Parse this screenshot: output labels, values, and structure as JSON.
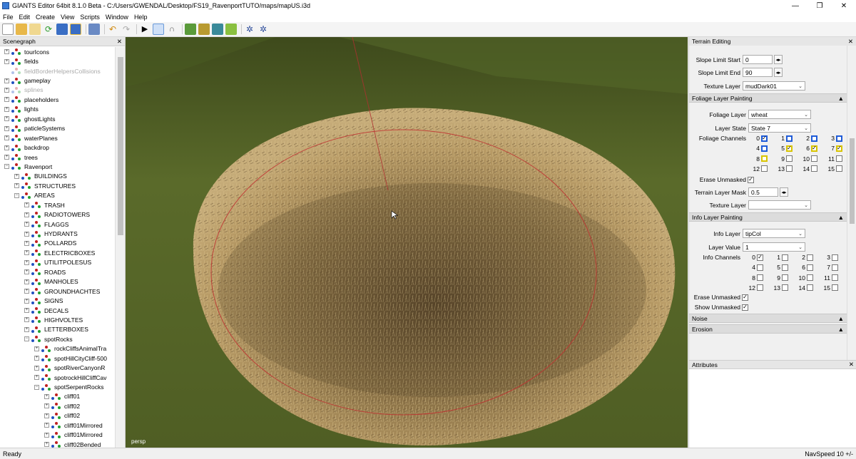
{
  "window": {
    "title": "GIANTS Editor 64bit 8.1.0 Beta - C:/Users/GWENDAL/Desktop/FS19_RavenportTUTO/maps/mapUS.i3d",
    "minimize": "—",
    "maximize": "❐",
    "close": "✕"
  },
  "menu": [
    "File",
    "Edit",
    "Create",
    "View",
    "Scripts",
    "Window",
    "Help"
  ],
  "scenegraph": {
    "title": "Scenegraph",
    "close": "✕",
    "nodes": [
      {
        "label": "tourIcons",
        "depth": 0,
        "exp": "+"
      },
      {
        "label": "fields",
        "depth": 0,
        "exp": "+"
      },
      {
        "label": "fieldBorderHelpersCollisions",
        "depth": 0,
        "exp": "",
        "dim": true
      },
      {
        "label": "gameplay",
        "depth": 0,
        "exp": "+"
      },
      {
        "label": "splines",
        "depth": 0,
        "exp": "+",
        "dim": true
      },
      {
        "label": "placeholders",
        "depth": 0,
        "exp": "+"
      },
      {
        "label": "lights",
        "depth": 0,
        "exp": "+"
      },
      {
        "label": "ghostLights",
        "depth": 0,
        "exp": "+"
      },
      {
        "label": "paticleSystems",
        "depth": 0,
        "exp": "+"
      },
      {
        "label": "waterPlanes",
        "depth": 0,
        "exp": "+"
      },
      {
        "label": "backdrop",
        "depth": 0,
        "exp": "+"
      },
      {
        "label": "trees",
        "depth": 0,
        "exp": "+"
      },
      {
        "label": "Ravenport",
        "depth": 0,
        "exp": "−"
      },
      {
        "label": "BUILDINGS",
        "depth": 1,
        "exp": "+"
      },
      {
        "label": "STRUCTURES",
        "depth": 1,
        "exp": "+"
      },
      {
        "label": "AREAS",
        "depth": 1,
        "exp": "−"
      },
      {
        "label": "TRASH",
        "depth": 2,
        "exp": "+"
      },
      {
        "label": "RADIOTOWERS",
        "depth": 2,
        "exp": "+"
      },
      {
        "label": "FLAGGS",
        "depth": 2,
        "exp": "+"
      },
      {
        "label": "HYDRANTS",
        "depth": 2,
        "exp": "+"
      },
      {
        "label": "POLLARDS",
        "depth": 2,
        "exp": "+"
      },
      {
        "label": "ELECTRICBOXES",
        "depth": 2,
        "exp": "+"
      },
      {
        "label": "UTILITPOLESUS",
        "depth": 2,
        "exp": "+"
      },
      {
        "label": "ROADS",
        "depth": 2,
        "exp": "+"
      },
      {
        "label": "MANHOLES",
        "depth": 2,
        "exp": "+"
      },
      {
        "label": "GROUNDHACHTES",
        "depth": 2,
        "exp": "+"
      },
      {
        "label": "SIGNS",
        "depth": 2,
        "exp": "+"
      },
      {
        "label": "DECALS",
        "depth": 2,
        "exp": "+"
      },
      {
        "label": "HIGHVOLTES",
        "depth": 2,
        "exp": "+"
      },
      {
        "label": "LETTERBOXES",
        "depth": 2,
        "exp": "+"
      },
      {
        "label": "spotRocks",
        "depth": 2,
        "exp": "−"
      },
      {
        "label": "rockCliffsAnimalTra",
        "depth": 3,
        "exp": "+"
      },
      {
        "label": "spotHillCityCliff-500",
        "depth": 3,
        "exp": "+"
      },
      {
        "label": "spotRiverCanyonR",
        "depth": 3,
        "exp": "+"
      },
      {
        "label": "spotrockHillCliffCav",
        "depth": 3,
        "exp": "+"
      },
      {
        "label": "spotSerpentRocks",
        "depth": 3,
        "exp": "−"
      },
      {
        "label": "cliff01",
        "depth": 4,
        "exp": "+"
      },
      {
        "label": "cliff02",
        "depth": 4,
        "exp": "+"
      },
      {
        "label": "cliff02",
        "depth": 4,
        "exp": "+"
      },
      {
        "label": "cliff01Mirrored",
        "depth": 4,
        "exp": "+"
      },
      {
        "label": "cliff01Mirrored",
        "depth": 4,
        "exp": "+"
      },
      {
        "label": "cliff02Bended",
        "depth": 4,
        "exp": "+"
      }
    ]
  },
  "viewport": {
    "label": "persp"
  },
  "terrain": {
    "title": "Terrain Editing",
    "close": "✕",
    "slope_start_label": "Slope Limit Start",
    "slope_start_value": "0",
    "slope_end_label": "Slope Limit End",
    "slope_end_value": "90",
    "texture_layer_label": "Texture Layer",
    "texture_layer_value": "mudDark01",
    "foliage_section": "Foliage Layer Painting",
    "foliage_layer_label": "Foliage Layer",
    "foliage_layer_value": "wheat",
    "layer_state_label": "Layer State",
    "layer_state_value": "State 7",
    "foliage_channels_label": "Foliage Channels",
    "foliage_channels": [
      {
        "n": "0",
        "s": "blue-checked"
      },
      {
        "n": "1",
        "s": "blue"
      },
      {
        "n": "2",
        "s": "blue"
      },
      {
        "n": "3",
        "s": "blue"
      },
      {
        "n": "4",
        "s": "blue"
      },
      {
        "n": "5",
        "s": "yellow-checked"
      },
      {
        "n": "6",
        "s": "yellow-checked"
      },
      {
        "n": "7",
        "s": "yellow-checked"
      },
      {
        "n": "8",
        "s": "yellow"
      },
      {
        "n": "9",
        "s": "plain"
      },
      {
        "n": "10",
        "s": "plain"
      },
      {
        "n": "11",
        "s": "plain"
      },
      {
        "n": "12",
        "s": "plain"
      },
      {
        "n": "13",
        "s": "plain"
      },
      {
        "n": "14",
        "s": "plain"
      },
      {
        "n": "15",
        "s": "plain"
      }
    ],
    "erase_unmasked_label": "Erase Unmasked",
    "layer_mask_label": "Terrain Layer Mask",
    "layer_mask_value": "0.5",
    "texture_layer2_label": "Texture Layer",
    "texture_layer2_value": "",
    "info_section": "Info Layer Painting",
    "info_layer_label": "Info Layer",
    "info_layer_value": "tipCol",
    "layer_value_label": "Layer Value",
    "layer_value_value": "1",
    "info_channels_label": "Info Channels",
    "info_channels": [
      {
        "n": "0",
        "s": "plain-checked"
      },
      {
        "n": "1",
        "s": "plain"
      },
      {
        "n": "2",
        "s": "plain"
      },
      {
        "n": "3",
        "s": "plain"
      },
      {
        "n": "4",
        "s": "plain"
      },
      {
        "n": "5",
        "s": "plain"
      },
      {
        "n": "6",
        "s": "plain"
      },
      {
        "n": "7",
        "s": "plain"
      },
      {
        "n": "8",
        "s": "plain"
      },
      {
        "n": "9",
        "s": "plain"
      },
      {
        "n": "10",
        "s": "plain"
      },
      {
        "n": "11",
        "s": "plain"
      },
      {
        "n": "12",
        "s": "plain"
      },
      {
        "n": "13",
        "s": "plain"
      },
      {
        "n": "14",
        "s": "plain"
      },
      {
        "n": "15",
        "s": "plain"
      }
    ],
    "erase_unmasked2_label": "Erase Unmasked",
    "show_unmasked_label": "Show Unmasked",
    "noise_section": "Noise",
    "erosion_section": "Erosion"
  },
  "attributes": {
    "title": "Attributes",
    "close": "✕"
  },
  "status": {
    "left": "Ready",
    "right": "NavSpeed 10 +/-"
  }
}
